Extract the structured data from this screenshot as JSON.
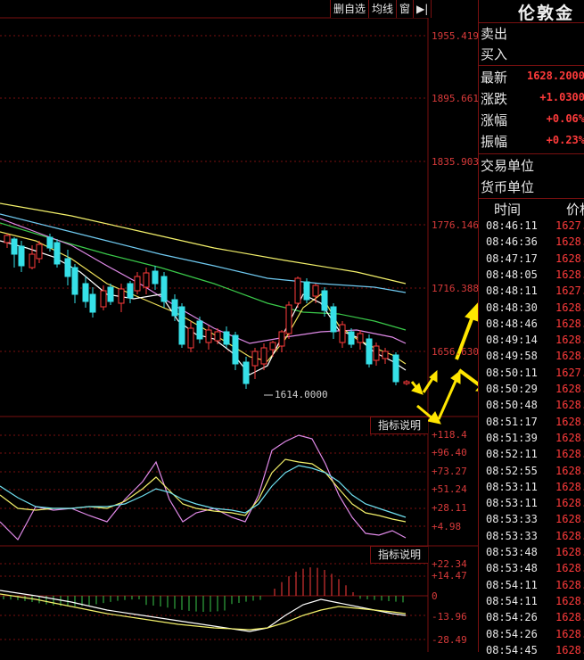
{
  "toolbar": {
    "delete_self_select": "删自选",
    "ma_line": "均线",
    "window": "窗",
    "expand_icon": "▶|"
  },
  "price_axis": [
    "1955.419",
    "1895.661",
    "1835.903",
    "1776.146",
    "1716.388",
    "1656.630"
  ],
  "min_price_label": "1614.0000",
  "indicator_button_1": "指标说明",
  "indicator_button_2": "指标说明",
  "kdj_axis": [
    "+118.4",
    "+96.40",
    "+73.27",
    "+51.24",
    "+28.11",
    "+4.98"
  ],
  "macd_axis": [
    "+22.34",
    "+14.47",
    "0",
    "-13.96",
    "-28.49"
  ],
  "panel": {
    "title": "伦敦金",
    "sell_label": "卖出",
    "buy_label": "买入",
    "latest_label": "最新",
    "latest_value": "1628.2000",
    "change_label": "涨跌",
    "change_value": "+1.0300",
    "change_pct_label": "涨幅",
    "change_pct_value": "+0.06%",
    "amplitude_label": "振幅",
    "amplitude_value": "+0.23%",
    "trade_unit_label": "交易单位",
    "currency_unit_label": "货币单位",
    "time_header": "时间",
    "price_header": "价格"
  },
  "ticks": [
    {
      "time": "08:46:11",
      "price": "1627."
    },
    {
      "time": "08:46:36",
      "price": "1628."
    },
    {
      "time": "08:47:17",
      "price": "1628."
    },
    {
      "time": "08:48:05",
      "price": "1628."
    },
    {
      "time": "08:48:11",
      "price": "1627."
    },
    {
      "time": "08:48:30",
      "price": "1628."
    },
    {
      "time": "08:48:46",
      "price": "1628."
    },
    {
      "time": "08:49:14",
      "price": "1628."
    },
    {
      "time": "08:49:58",
      "price": "1628."
    },
    {
      "time": "08:50:11",
      "price": "1627."
    },
    {
      "time": "08:50:29",
      "price": "1628."
    },
    {
      "time": "08:50:48",
      "price": "1628."
    },
    {
      "time": "08:51:17",
      "price": "1628."
    },
    {
      "time": "08:51:39",
      "price": "1628."
    },
    {
      "time": "08:52:11",
      "price": "1628."
    },
    {
      "time": "08:52:55",
      "price": "1628."
    },
    {
      "time": "08:53:11",
      "price": "1628."
    },
    {
      "time": "08:53:11",
      "price": "1628."
    },
    {
      "time": "08:53:33",
      "price": "1628."
    },
    {
      "time": "08:53:33",
      "price": "1628."
    },
    {
      "time": "08:53:48",
      "price": "1628."
    },
    {
      "time": "08:53:48",
      "price": "1628."
    },
    {
      "time": "08:54:11",
      "price": "1628."
    },
    {
      "time": "08:54:11",
      "price": "1628."
    },
    {
      "time": "08:54:26",
      "price": "1628."
    },
    {
      "time": "08:54:26",
      "price": "1628."
    },
    {
      "time": "08:54:45",
      "price": "1628."
    }
  ],
  "colors": {
    "up": "#ff3b3b",
    "down": "#36e0e8",
    "grid": "#7a1010",
    "arrow": "#ffe600"
  }
}
